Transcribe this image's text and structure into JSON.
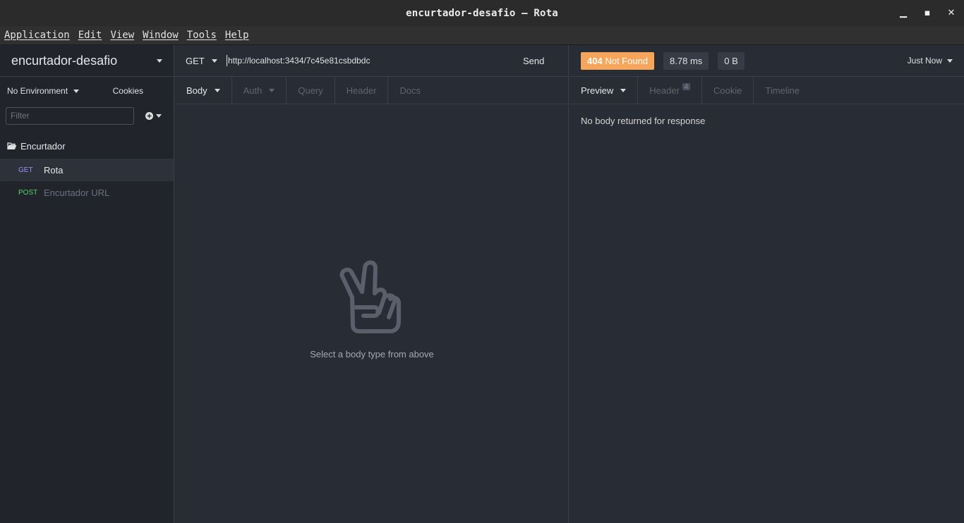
{
  "window": {
    "title": "encurtador-desafio — Rota",
    "controls": {
      "minimize": "▁",
      "maximize": "▪",
      "close": "✕"
    }
  },
  "menu": [
    "Application",
    "Edit",
    "View",
    "Window",
    "Tools",
    "Help"
  ],
  "sidebar": {
    "workspace": "encurtador-desafio",
    "environment": "No Environment",
    "cookies": "Cookies",
    "filter_placeholder": "Filter",
    "folder": "Encurtador",
    "requests": [
      {
        "method": "GET",
        "name": "Rota",
        "method_color": "#a78bfa",
        "name_color": "#e6e6e6"
      },
      {
        "method": "POST",
        "name": "Encurtador URL",
        "method_color": "#59d36a",
        "name_color": "#6a7080"
      }
    ]
  },
  "request": {
    "method": "GET",
    "url": "http://localhost:3434/7c45e81csbdbdc",
    "send": "Send",
    "tabs": [
      "Body",
      "Auth",
      "Query",
      "Header",
      "Docs"
    ],
    "empty_message": "Select a body type from above"
  },
  "response": {
    "status_code": "404",
    "status_text": "Not Found",
    "status_color": "#f5a65b",
    "time": "8.78 ms",
    "size": "0 B",
    "history": "Just Now",
    "tabs": [
      "Preview",
      "Header",
      "Cookie",
      "Timeline"
    ],
    "header_count": "4",
    "body_message": "No body returned for response"
  },
  "colors": {
    "accent_purple": "#a78bfa",
    "post_green": "#59d36a",
    "status_orange": "#f5a65b"
  }
}
